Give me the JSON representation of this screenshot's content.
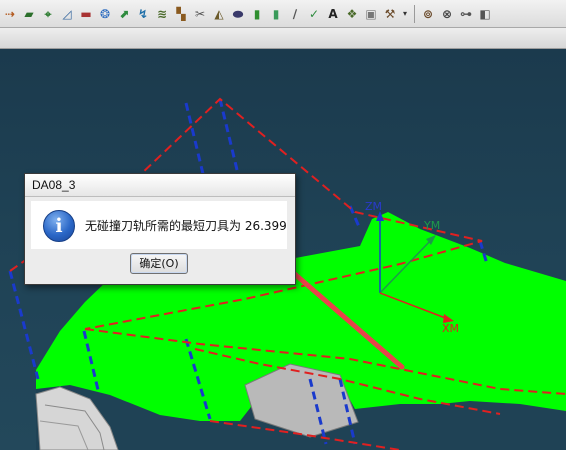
{
  "toolbar": {
    "tools": [
      {
        "icon": "dotted-arrow-icon",
        "glyph": "⇢",
        "color": "#b35a1f"
      },
      {
        "icon": "flag-icon",
        "glyph": "▰",
        "color": "#2b6f2b"
      },
      {
        "icon": "transform-icon",
        "glyph": "⌖",
        "color": "#2e7d32"
      },
      {
        "icon": "sketch-icon",
        "glyph": "◿",
        "color": "#3b6aa0"
      },
      {
        "icon": "flag-red-icon",
        "glyph": "▬",
        "color": "#a83232"
      },
      {
        "icon": "mill-icon",
        "glyph": "❂",
        "color": "#2a6abf"
      },
      {
        "icon": "path-icon",
        "glyph": "⬈",
        "color": "#2e8b3e"
      },
      {
        "icon": "curve-icon",
        "glyph": "↯",
        "color": "#1f6fa8"
      },
      {
        "icon": "layers-icon",
        "glyph": "≋",
        "color": "#4a6a2a"
      },
      {
        "icon": "steps-icon",
        "glyph": "▚",
        "color": "#8a5a1f"
      },
      {
        "icon": "cut-icon",
        "glyph": "✂",
        "color": "#555555"
      },
      {
        "icon": "shade-icon",
        "glyph": "◭",
        "color": "#6b5a2a"
      },
      {
        "icon": "pill-icon",
        "glyph": "⬬",
        "color": "#3a3a6a"
      },
      {
        "icon": "bar-green-icon",
        "glyph": "▮",
        "color": "#2f8f2f"
      },
      {
        "icon": "bar-green2-icon",
        "glyph": "▮",
        "color": "#3a9a5a"
      },
      {
        "icon": "slash-icon",
        "glyph": "∕",
        "color": "#555555"
      },
      {
        "icon": "check-icon",
        "glyph": "✓",
        "color": "#2e8b3e"
      },
      {
        "icon": "text-icon",
        "glyph": "A",
        "color": "#222222"
      },
      {
        "icon": "comment-icon",
        "glyph": "❖",
        "color": "#4a6a2a"
      },
      {
        "icon": "image-icon",
        "glyph": "▣",
        "color": "#777777"
      },
      {
        "icon": "wand-icon",
        "glyph": "⚒",
        "color": "#6a4a2a"
      }
    ],
    "tools_right": [
      {
        "icon": "tool-holder-icon",
        "glyph": "⊚",
        "color": "#6a4a2a"
      },
      {
        "icon": "probe-icon",
        "glyph": "⊗",
        "color": "#444444"
      },
      {
        "icon": "connector-icon",
        "glyph": "⊶",
        "color": "#555555"
      },
      {
        "icon": "cube-icon",
        "glyph": "◧",
        "color": "#555555"
      }
    ]
  },
  "viewport": {
    "axes": {
      "zm": "ZM",
      "ym": "YM",
      "xm": "XM"
    }
  },
  "dialog": {
    "title": "DA08_3",
    "message": "无碰撞刀轨所需的最短刀具为 26.399",
    "ok_label": "确定(O)"
  },
  "colors": {
    "surface": "#00ff00",
    "red_dash": "#e02020",
    "blue_dash": "#1a3acc",
    "arrow": "#e8434a"
  }
}
